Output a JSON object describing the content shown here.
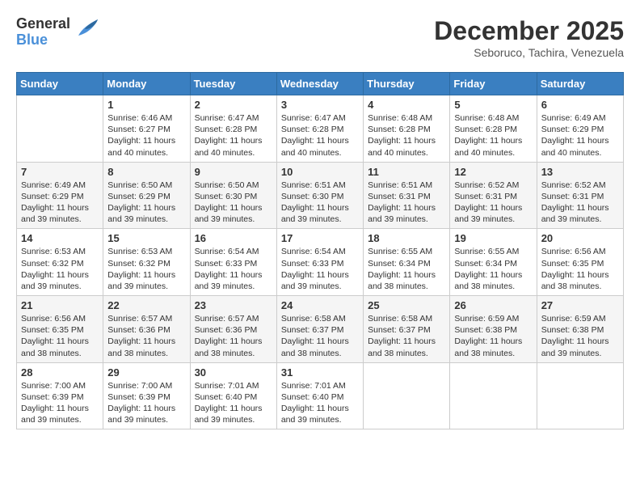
{
  "header": {
    "logo_general": "General",
    "logo_blue": "Blue",
    "month_year": "December 2025",
    "location": "Seboruco, Tachira, Venezuela"
  },
  "days_of_week": [
    "Sunday",
    "Monday",
    "Tuesday",
    "Wednesday",
    "Thursday",
    "Friday",
    "Saturday"
  ],
  "weeks": [
    [
      {
        "date": "",
        "sunrise": "",
        "sunset": "",
        "daylight": ""
      },
      {
        "date": "1",
        "sunrise": "Sunrise: 6:46 AM",
        "sunset": "Sunset: 6:27 PM",
        "daylight": "Daylight: 11 hours and 40 minutes."
      },
      {
        "date": "2",
        "sunrise": "Sunrise: 6:47 AM",
        "sunset": "Sunset: 6:28 PM",
        "daylight": "Daylight: 11 hours and 40 minutes."
      },
      {
        "date": "3",
        "sunrise": "Sunrise: 6:47 AM",
        "sunset": "Sunset: 6:28 PM",
        "daylight": "Daylight: 11 hours and 40 minutes."
      },
      {
        "date": "4",
        "sunrise": "Sunrise: 6:48 AM",
        "sunset": "Sunset: 6:28 PM",
        "daylight": "Daylight: 11 hours and 40 minutes."
      },
      {
        "date": "5",
        "sunrise": "Sunrise: 6:48 AM",
        "sunset": "Sunset: 6:28 PM",
        "daylight": "Daylight: 11 hours and 40 minutes."
      },
      {
        "date": "6",
        "sunrise": "Sunrise: 6:49 AM",
        "sunset": "Sunset: 6:29 PM",
        "daylight": "Daylight: 11 hours and 40 minutes."
      }
    ],
    [
      {
        "date": "7",
        "sunrise": "Sunrise: 6:49 AM",
        "sunset": "Sunset: 6:29 PM",
        "daylight": "Daylight: 11 hours and 39 minutes."
      },
      {
        "date": "8",
        "sunrise": "Sunrise: 6:50 AM",
        "sunset": "Sunset: 6:29 PM",
        "daylight": "Daylight: 11 hours and 39 minutes."
      },
      {
        "date": "9",
        "sunrise": "Sunrise: 6:50 AM",
        "sunset": "Sunset: 6:30 PM",
        "daylight": "Daylight: 11 hours and 39 minutes."
      },
      {
        "date": "10",
        "sunrise": "Sunrise: 6:51 AM",
        "sunset": "Sunset: 6:30 PM",
        "daylight": "Daylight: 11 hours and 39 minutes."
      },
      {
        "date": "11",
        "sunrise": "Sunrise: 6:51 AM",
        "sunset": "Sunset: 6:31 PM",
        "daylight": "Daylight: 11 hours and 39 minutes."
      },
      {
        "date": "12",
        "sunrise": "Sunrise: 6:52 AM",
        "sunset": "Sunset: 6:31 PM",
        "daylight": "Daylight: 11 hours and 39 minutes."
      },
      {
        "date": "13",
        "sunrise": "Sunrise: 6:52 AM",
        "sunset": "Sunset: 6:31 PM",
        "daylight": "Daylight: 11 hours and 39 minutes."
      }
    ],
    [
      {
        "date": "14",
        "sunrise": "Sunrise: 6:53 AM",
        "sunset": "Sunset: 6:32 PM",
        "daylight": "Daylight: 11 hours and 39 minutes."
      },
      {
        "date": "15",
        "sunrise": "Sunrise: 6:53 AM",
        "sunset": "Sunset: 6:32 PM",
        "daylight": "Daylight: 11 hours and 39 minutes."
      },
      {
        "date": "16",
        "sunrise": "Sunrise: 6:54 AM",
        "sunset": "Sunset: 6:33 PM",
        "daylight": "Daylight: 11 hours and 39 minutes."
      },
      {
        "date": "17",
        "sunrise": "Sunrise: 6:54 AM",
        "sunset": "Sunset: 6:33 PM",
        "daylight": "Daylight: 11 hours and 39 minutes."
      },
      {
        "date": "18",
        "sunrise": "Sunrise: 6:55 AM",
        "sunset": "Sunset: 6:34 PM",
        "daylight": "Daylight: 11 hours and 38 minutes."
      },
      {
        "date": "19",
        "sunrise": "Sunrise: 6:55 AM",
        "sunset": "Sunset: 6:34 PM",
        "daylight": "Daylight: 11 hours and 38 minutes."
      },
      {
        "date": "20",
        "sunrise": "Sunrise: 6:56 AM",
        "sunset": "Sunset: 6:35 PM",
        "daylight": "Daylight: 11 hours and 38 minutes."
      }
    ],
    [
      {
        "date": "21",
        "sunrise": "Sunrise: 6:56 AM",
        "sunset": "Sunset: 6:35 PM",
        "daylight": "Daylight: 11 hours and 38 minutes."
      },
      {
        "date": "22",
        "sunrise": "Sunrise: 6:57 AM",
        "sunset": "Sunset: 6:36 PM",
        "daylight": "Daylight: 11 hours and 38 minutes."
      },
      {
        "date": "23",
        "sunrise": "Sunrise: 6:57 AM",
        "sunset": "Sunset: 6:36 PM",
        "daylight": "Daylight: 11 hours and 38 minutes."
      },
      {
        "date": "24",
        "sunrise": "Sunrise: 6:58 AM",
        "sunset": "Sunset: 6:37 PM",
        "daylight": "Daylight: 11 hours and 38 minutes."
      },
      {
        "date": "25",
        "sunrise": "Sunrise: 6:58 AM",
        "sunset": "Sunset: 6:37 PM",
        "daylight": "Daylight: 11 hours and 38 minutes."
      },
      {
        "date": "26",
        "sunrise": "Sunrise: 6:59 AM",
        "sunset": "Sunset: 6:38 PM",
        "daylight": "Daylight: 11 hours and 38 minutes."
      },
      {
        "date": "27",
        "sunrise": "Sunrise: 6:59 AM",
        "sunset": "Sunset: 6:38 PM",
        "daylight": "Daylight: 11 hours and 39 minutes."
      }
    ],
    [
      {
        "date": "28",
        "sunrise": "Sunrise: 7:00 AM",
        "sunset": "Sunset: 6:39 PM",
        "daylight": "Daylight: 11 hours and 39 minutes."
      },
      {
        "date": "29",
        "sunrise": "Sunrise: 7:00 AM",
        "sunset": "Sunset: 6:39 PM",
        "daylight": "Daylight: 11 hours and 39 minutes."
      },
      {
        "date": "30",
        "sunrise": "Sunrise: 7:01 AM",
        "sunset": "Sunset: 6:40 PM",
        "daylight": "Daylight: 11 hours and 39 minutes."
      },
      {
        "date": "31",
        "sunrise": "Sunrise: 7:01 AM",
        "sunset": "Sunset: 6:40 PM",
        "daylight": "Daylight: 11 hours and 39 minutes."
      },
      {
        "date": "",
        "sunrise": "",
        "sunset": "",
        "daylight": ""
      },
      {
        "date": "",
        "sunrise": "",
        "sunset": "",
        "daylight": ""
      },
      {
        "date": "",
        "sunrise": "",
        "sunset": "",
        "daylight": ""
      }
    ]
  ]
}
